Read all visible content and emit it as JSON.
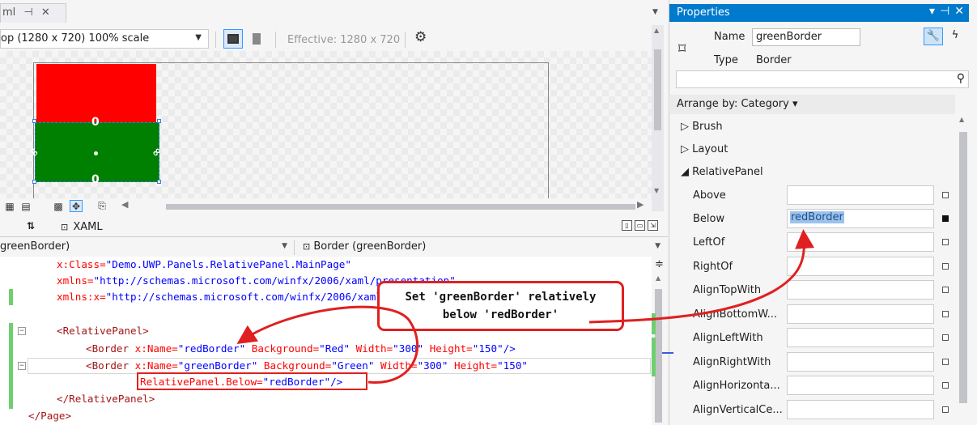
{
  "doc_tab": {
    "label": "ml",
    "pin": "⊣",
    "close": "✕"
  },
  "toolbar": {
    "device": "op (1280 x 720) 100% scale",
    "effective": "Effective: 1280 x 720"
  },
  "split": {
    "xaml_tab": "XAML"
  },
  "nav": {
    "left": "greenBorder)",
    "right": "Border (greenBorder)"
  },
  "code": {
    "l1_attr": "x:Class=",
    "l1_val": "\"Demo.UWP.Panels.RelativePanel.MainPage\"",
    "l2_attr": "xmlns=",
    "l2_val": "\"http://schemas.microsoft.com/winfx/2006/xaml/presentation\"",
    "l3_attr": "xmlns:x=",
    "l3_val": "\"http://schemas.microsoft.com/winfx/2006/xaml\"",
    "l5": "<RelativePanel>",
    "l6_open": "<Border",
    "l6_a1": "x:Name=",
    "l6_v1": "\"redBorder\"",
    "l6_a2": "Background=",
    "l6_v2": "\"Red\"",
    "l6_a3": "Width=",
    "l6_v3": "\"300\"",
    "l6_a4": "Height=",
    "l6_v4": "\"150\"",
    "l6_close": "/>",
    "l7_open": "<Border",
    "l7_a1": "x:Name=",
    "l7_v1": "\"greenBorder\"",
    "l7_a2": "Background=",
    "l7_v2": "\"Green\"",
    "l7_a3": "Width=",
    "l7_v3": "\"300\"",
    "l7_a4": "Height=",
    "l7_v4": "\"150\"",
    "l8_attr": "RelativePanel.Below=",
    "l8_val": "\"redBorder\"",
    "l8_close": "/>",
    "l9": "</RelativePanel>",
    "l10": "</Page>"
  },
  "callout": {
    "line1": "Set 'greenBorder' relatively",
    "line2": "below 'redBorder'"
  },
  "props": {
    "title": "Properties",
    "name_label": "Name",
    "name_value": "greenBorder",
    "type_label": "Type",
    "type_value": "Border",
    "arrange": "Arrange by: Category ▾",
    "categories": {
      "brush": "Brush",
      "layout": "Layout",
      "relative": "RelativePanel"
    },
    "rows": [
      {
        "label": "Above",
        "value": ""
      },
      {
        "label": "Below",
        "value": "redBorder"
      },
      {
        "label": "LeftOf",
        "value": ""
      },
      {
        "label": "RightOf",
        "value": ""
      },
      {
        "label": "AlignTopWith",
        "value": ""
      },
      {
        "label": "AlignBottomW...",
        "value": ""
      },
      {
        "label": "AlignLeftWith",
        "value": ""
      },
      {
        "label": "AlignRightWith",
        "value": ""
      },
      {
        "label": "AlignHorizonta...",
        "value": ""
      },
      {
        "label": "AlignVerticalCe...",
        "value": ""
      }
    ]
  },
  "colors": {
    "accent": "#007acc",
    "annotation": "#e02020",
    "red_rect": "#ff0000",
    "green_rect": "#008000"
  }
}
